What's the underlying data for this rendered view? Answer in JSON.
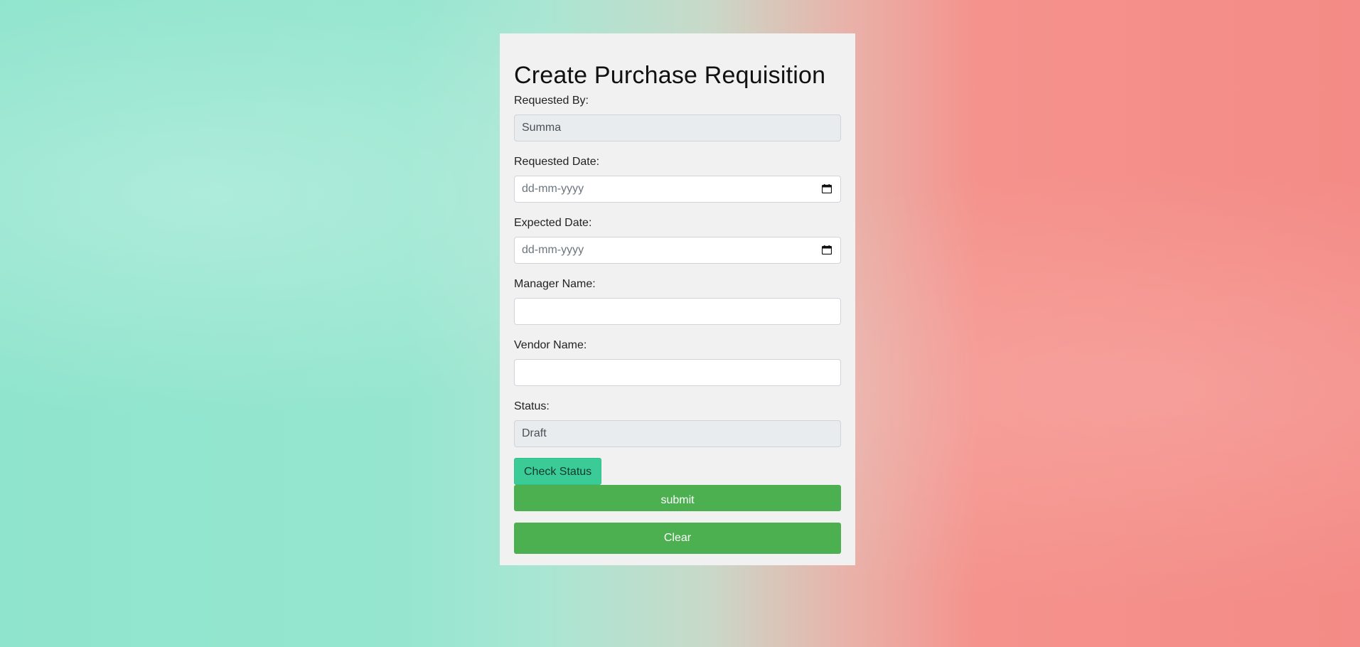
{
  "form": {
    "title": "Create Purchase Requisition",
    "requested_by": {
      "label": "Requested By:",
      "value": "Summa"
    },
    "requested_date": {
      "label": "Requested Date:",
      "placeholder": "dd-mm-yyyy"
    },
    "expected_date": {
      "label": "Expected Date:",
      "placeholder": "dd-mm-yyyy"
    },
    "manager_name": {
      "label": "Manager Name:",
      "value": ""
    },
    "vendor_name": {
      "label": "Vendor Name:",
      "value": ""
    },
    "status": {
      "label": "Status:",
      "value": "Draft"
    },
    "check_status_label": "Check Status",
    "submit_label": "submit",
    "clear_label": "Clear"
  },
  "colors": {
    "primary_button": "#4caf50",
    "check_status_button": "#3acb96",
    "card_background": "#f1f1f1"
  },
  "icons": {
    "date_picker": "calendar-icon"
  }
}
